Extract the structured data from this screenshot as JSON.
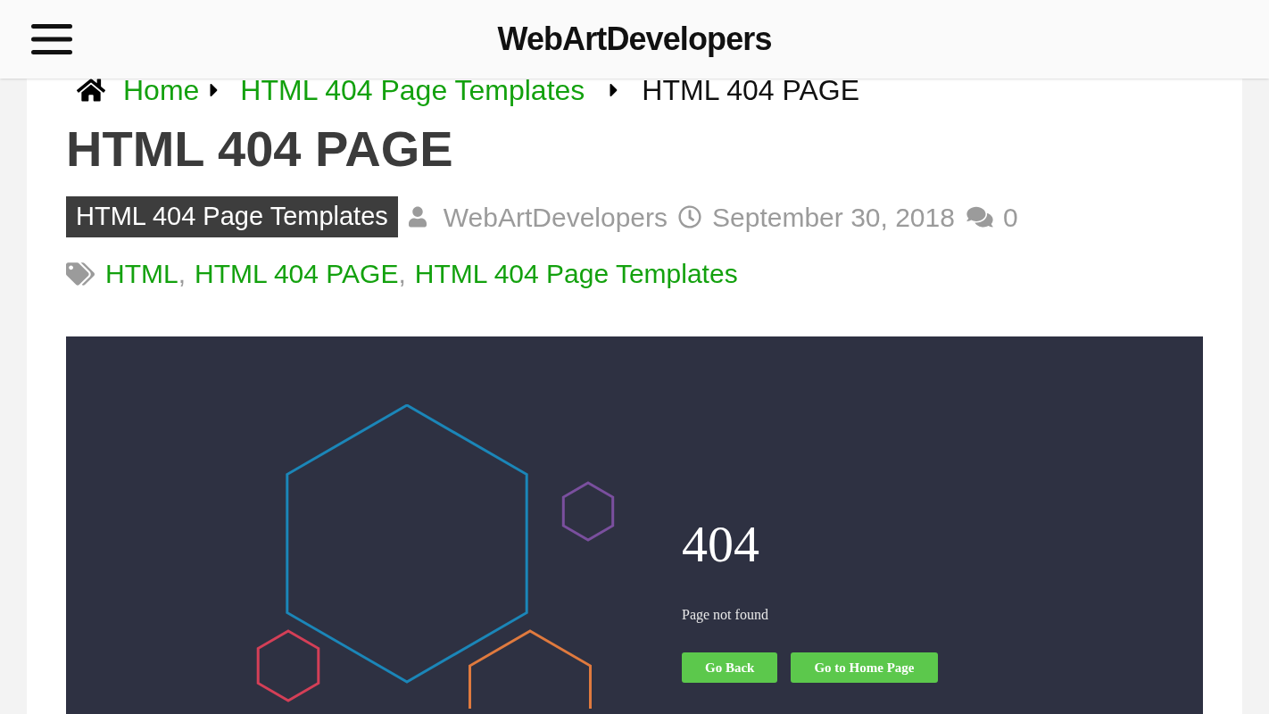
{
  "header": {
    "title": "WebArtDevelopers"
  },
  "breadcrumb": [
    {
      "label": "Home",
      "kind": "link"
    },
    {
      "label": "HTML 404 Page Templates",
      "kind": "link"
    },
    {
      "label": "HTML 404 PAGE",
      "kind": "current"
    }
  ],
  "article": {
    "title": "HTML 404 PAGE",
    "category": "HTML 404 Page Templates",
    "author": "WebArtDevelopers",
    "date": "September 30, 2018",
    "comments": "0"
  },
  "tags": [
    {
      "label": "HTML",
      "separator": ","
    },
    {
      "label": "HTML 404 PAGE",
      "separator": ","
    },
    {
      "label": "HTML 404 Page Templates"
    }
  ],
  "preview": {
    "code": "404",
    "message": "Page not found",
    "buttons": [
      "Go Back",
      "Go to Home Page"
    ]
  }
}
